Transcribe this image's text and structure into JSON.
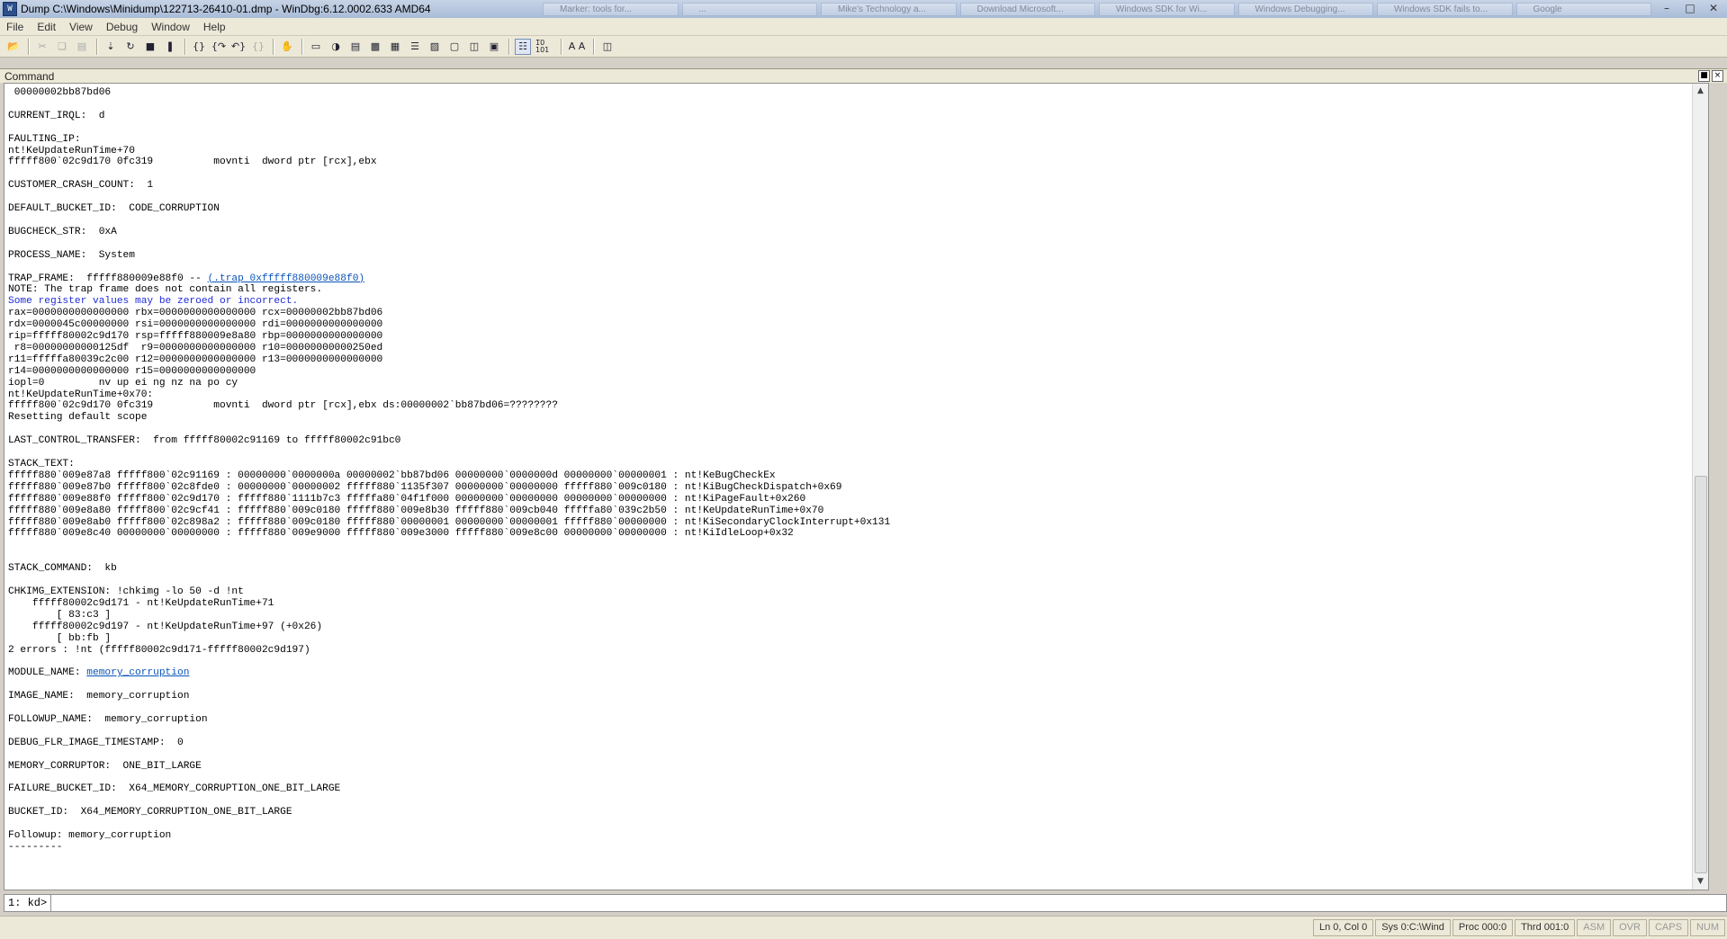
{
  "window": {
    "title": "Dump C:\\Windows\\Minidump\\122713-26410-01.dmp - WinDbg:6.12.0002.633 AMD64",
    "background_tabs": [
      "Marker: tools for...",
      "...",
      "Mike's Technology a...",
      "Download Microsoft...",
      "Windows SDK for Wi...",
      "Windows Debugging...",
      "Windows SDK fails to...",
      "Google"
    ]
  },
  "menu": [
    "File",
    "Edit",
    "View",
    "Debug",
    "Window",
    "Help"
  ],
  "toolbar": {
    "icons": [
      "open-icon",
      "cut-icon",
      "copy-icon",
      "paste-icon",
      "go-icon",
      "restart-icon",
      "stop-icon",
      "break-icon",
      "step-into-icon",
      "step-over-icon",
      "step-out-icon",
      "run-to-cursor-icon",
      "hand-icon",
      "command-window-icon",
      "watch-window-icon",
      "locals-window-icon",
      "registers-window-icon",
      "memory-window-icon",
      "call-stack-window-icon",
      "disassembly-window-icon",
      "scratch-pad-icon",
      "processes-window-icon",
      "source-mode-icon",
      "font-icon",
      "options-icon"
    ],
    "glyph_source_mode": "1̅0 101",
    "glyph_font": "A A"
  },
  "command_pane": {
    "title": "Command",
    "lines": [
      " 00000002bb87bd06",
      "",
      "CURRENT_IRQL:  d",
      "",
      "FAULTING_IP: ",
      "nt!KeUpdateRunTime+70",
      "fffff800`02c9d170 0fc319          movnti  dword ptr [rcx],ebx",
      "",
      "CUSTOMER_CRASH_COUNT:  1",
      "",
      "DEFAULT_BUCKET_ID:  CODE_CORRUPTION",
      "",
      "BUGCHECK_STR:  0xA",
      "",
      "PROCESS_NAME:  System",
      "",
      "TRAP_FRAME:  fffff880009e88f0 -- ",
      "NOTE: The trap frame does not contain all registers.",
      "Some register values may be zeroed or incorrect.",
      "rax=0000000000000000 rbx=0000000000000000 rcx=00000002bb87bd06",
      "rdx=0000045c00000000 rsi=0000000000000000 rdi=0000000000000000",
      "rip=fffff80002c9d170 rsp=fffff880009e8a80 rbp=0000000000000000",
      " r8=00000000000125df  r9=0000000000000000 r10=00000000000250ed",
      "r11=fffffa80039c2c00 r12=0000000000000000 r13=0000000000000000",
      "r14=0000000000000000 r15=0000000000000000",
      "iopl=0         nv up ei ng nz na po cy",
      "nt!KeUpdateRunTime+0x70:",
      "fffff800`02c9d170 0fc319          movnti  dword ptr [rcx],ebx ds:00000002`bb87bd06=????????",
      "Resetting default scope",
      "",
      "LAST_CONTROL_TRANSFER:  from fffff80002c91169 to fffff80002c91bc0",
      "",
      "STACK_TEXT:  ",
      "fffff880`009e87a8 fffff800`02c91169 : 00000000`0000000a 00000002`bb87bd06 00000000`0000000d 00000000`00000001 : nt!KeBugCheckEx",
      "fffff880`009e87b0 fffff800`02c8fde0 : 00000000`00000002 fffff880`1135f307 00000000`00000000 fffff880`009c0180 : nt!KiBugCheckDispatch+0x69",
      "fffff880`009e88f0 fffff800`02c9d170 : fffff880`1111b7c3 fffffa80`04f1f000 00000000`00000000 00000000`00000000 : nt!KiPageFault+0x260",
      "fffff880`009e8a80 fffff800`02c9cf41 : fffff880`009c0180 fffff880`009e8b30 fffff880`009cb040 fffffa80`039c2b50 : nt!KeUpdateRunTime+0x70",
      "fffff880`009e8ab0 fffff800`02c898a2 : fffff880`009c0180 fffff880`00000001 00000000`00000001 fffff880`00000000 : nt!KiSecondaryClockInterrupt+0x131",
      "fffff880`009e8c40 00000000`00000000 : fffff880`009e9000 fffff880`009e3000 fffff880`009e8c00 00000000`00000000 : nt!KiIdleLoop+0x32",
      "",
      "",
      "STACK_COMMAND:  kb",
      "",
      "CHKIMG_EXTENSION: !chkimg -lo 50 -d !nt",
      "    fffff80002c9d171 - nt!KeUpdateRunTime+71",
      "\t[ 83:c3 ]",
      "    fffff80002c9d197 - nt!KeUpdateRunTime+97 (+0x26)",
      "\t[ bb:fb ]",
      "2 errors : !nt (fffff80002c9d171-fffff80002c9d197)",
      "",
      "MODULE_NAME: ",
      "",
      "IMAGE_NAME:  memory_corruption",
      "",
      "FOLLOWUP_NAME:  memory_corruption",
      "",
      "DEBUG_FLR_IMAGE_TIMESTAMP:  0",
      "",
      "MEMORY_CORRUPTOR:  ONE_BIT_LARGE",
      "",
      "FAILURE_BUCKET_ID:  X64_MEMORY_CORRUPTION_ONE_BIT_LARGE",
      "",
      "BUCKET_ID:  X64_MEMORY_CORRUPTION_ONE_BIT_LARGE",
      "",
      "Followup: memory_corruption",
      "---------"
    ],
    "trap_frame_link": "(.trap 0xfffff880009e88f0)",
    "module_name_link": "memory_corruption",
    "blue_line_index": 18,
    "link_color": "#0b54b8",
    "warning_color": "#1e2bd8"
  },
  "prompt": {
    "label": "1: kd>",
    "value": ""
  },
  "status": [
    {
      "text": "Ln 0, Col 0",
      "active": true
    },
    {
      "text": "Sys 0:C:\\Wind",
      "active": true
    },
    {
      "text": "Proc 000:0",
      "active": true
    },
    {
      "text": "Thrd 001:0",
      "active": true
    },
    {
      "text": "ASM",
      "active": false
    },
    {
      "text": "OVR",
      "active": false
    },
    {
      "text": "CAPS",
      "active": false
    },
    {
      "text": "NUM",
      "active": false
    }
  ]
}
